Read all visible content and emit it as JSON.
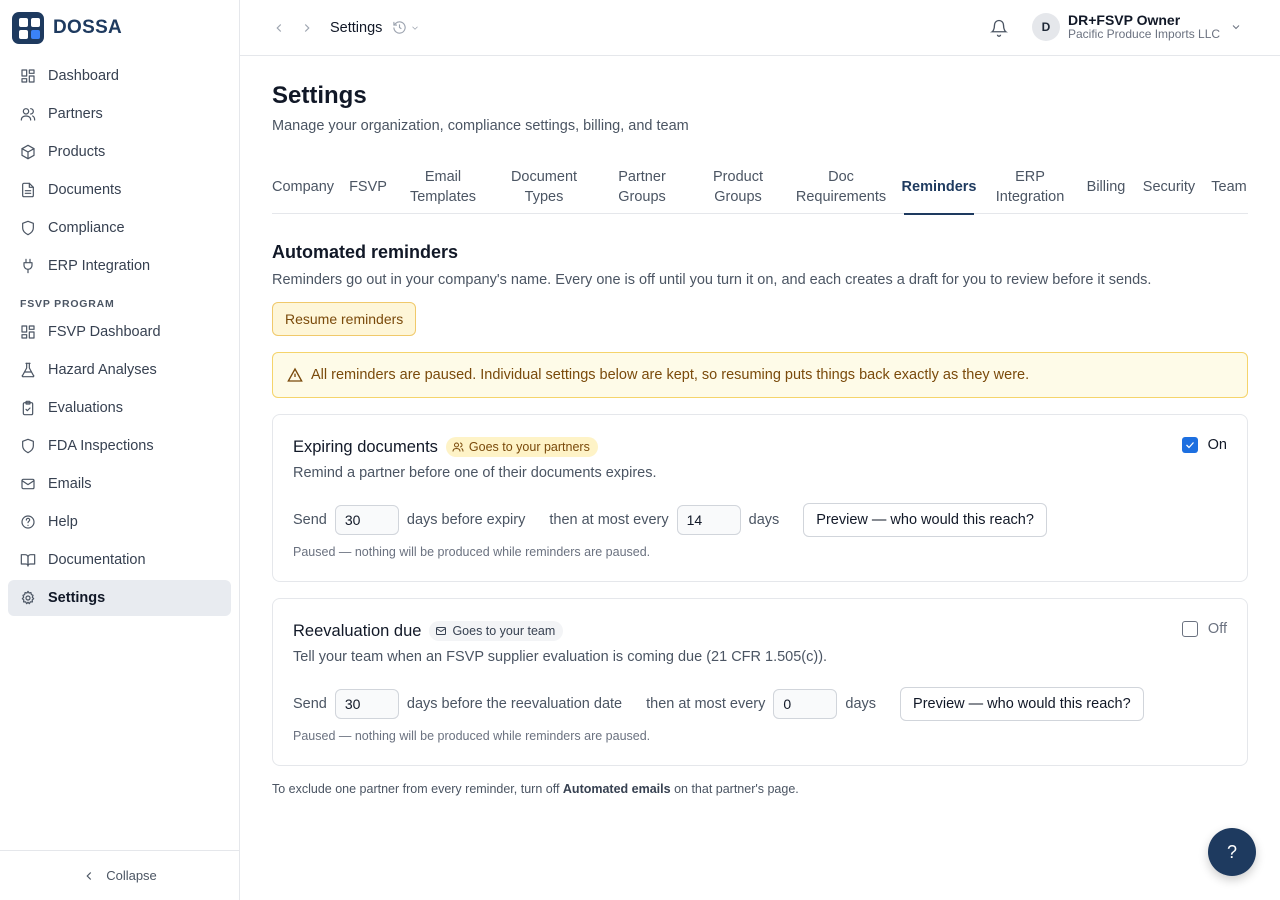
{
  "brand": {
    "name": "DOSSA"
  },
  "sidebar": {
    "items": [
      {
        "label": "Dashboard",
        "icon": "dashboard-icon"
      },
      {
        "label": "Partners",
        "icon": "users-icon"
      },
      {
        "label": "Products",
        "icon": "box-icon"
      },
      {
        "label": "Documents",
        "icon": "file-icon"
      },
      {
        "label": "Compliance",
        "icon": "shield-icon"
      },
      {
        "label": "ERP Integration",
        "icon": "plug-icon"
      }
    ],
    "section_label": "FSVP PROGRAM",
    "fsvp_items": [
      {
        "label": "FSVP Dashboard",
        "icon": "dashboard-icon"
      },
      {
        "label": "Hazard Analyses",
        "icon": "flask-icon"
      },
      {
        "label": "Evaluations",
        "icon": "clipboard-icon"
      },
      {
        "label": "FDA Inspections",
        "icon": "shield-icon"
      },
      {
        "label": "Emails",
        "icon": "mail-icon"
      },
      {
        "label": "Help",
        "icon": "help-circle-icon"
      },
      {
        "label": "Documentation",
        "icon": "book-icon"
      },
      {
        "label": "Settings",
        "icon": "gear-icon",
        "active": true
      }
    ],
    "collapse_label": "Collapse"
  },
  "topbar": {
    "breadcrumb": "Settings",
    "user_initial": "D",
    "user_name": "DR+FSVP Owner",
    "user_org": "Pacific Produce Imports LLC"
  },
  "page": {
    "title": "Settings",
    "subtitle": "Manage your organization, compliance settings, billing, and team"
  },
  "tabs": [
    {
      "label": "Company"
    },
    {
      "label": "FSVP"
    },
    {
      "label": "Email Templates"
    },
    {
      "label": "Document Types"
    },
    {
      "label": "Partner Groups"
    },
    {
      "label": "Product Groups"
    },
    {
      "label": "Doc Requirements"
    },
    {
      "label": "Reminders",
      "active": true
    },
    {
      "label": "ERP Integration"
    },
    {
      "label": "Billing"
    },
    {
      "label": "Security"
    },
    {
      "label": "Team"
    }
  ],
  "reminders": {
    "title": "Automated reminders",
    "description": "Reminders go out in your company's name. Every one is off until you turn it on, and each creates a draft for you to review before it sends.",
    "resume_label": "Resume reminders",
    "alert": "All reminders are paused. Individual settings below are kept, so resuming puts things back exactly as they were.",
    "cards": [
      {
        "title": "Expiring documents",
        "badge": "Goes to your partners",
        "description": "Remind a partner before one of their documents expires.",
        "enabled": true,
        "toggle_label": "On",
        "send_label": "Send",
        "days_before": "30",
        "days_before_label": "days before expiry",
        "every_label": "then at most every",
        "every_days": "14",
        "days_label": "days",
        "preview_label": "Preview — who would this reach?",
        "paused_note": "Paused — nothing will be produced while reminders are paused."
      },
      {
        "title": "Reevaluation due",
        "badge": "Goes to your team",
        "description": "Tell your team when an FSVP supplier evaluation is coming due (21 CFR 1.505(c)).",
        "enabled": false,
        "toggle_label": "Off",
        "send_label": "Send",
        "days_before": "30",
        "days_before_label": "days before the reevaluation date",
        "every_label": "then at most every",
        "every_days": "0",
        "days_label": "days",
        "preview_label": "Preview — who would this reach?",
        "paused_note": "Paused — nothing will be produced while reminders are paused."
      }
    ],
    "footnote_pre": "To exclude one partner from every reminder, turn off",
    "footnote_bold": "Automated emails",
    "footnote_post": "on that partner's page."
  },
  "help_fab": "?",
  "colors": {
    "brand": "#1e3a5f",
    "accent": "#1d6fe0",
    "warning_bg": "#fefbe8",
    "warning_border": "#f5d46b"
  }
}
